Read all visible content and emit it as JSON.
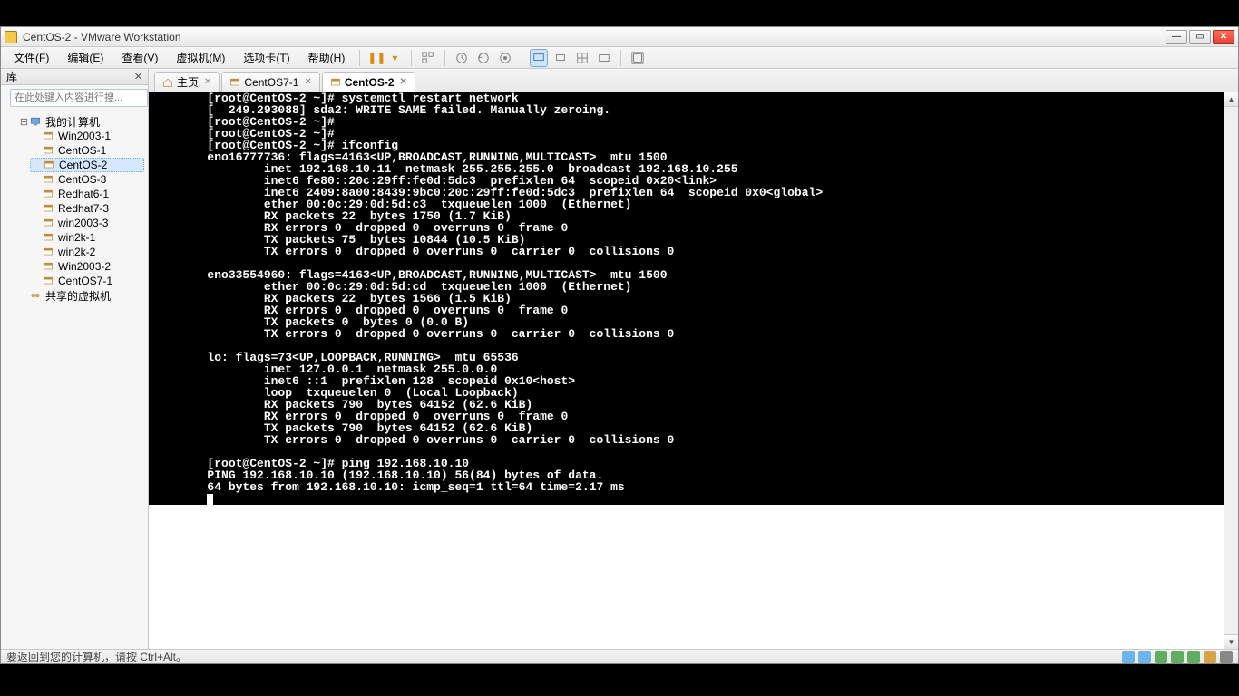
{
  "window": {
    "title": "CentOS-2 - VMware Workstation",
    "min": "—",
    "max": "▭",
    "close": "✕"
  },
  "menu": {
    "file": "文件(F)",
    "edit": "编辑(E)",
    "view": "查看(V)",
    "vm": "虚拟机(M)",
    "tabs": "选项卡(T)",
    "help": "帮助(H)"
  },
  "sidebar": {
    "header": "库",
    "search_placeholder": "在此处键入内容进行搜...",
    "root": "我的计算机",
    "items": [
      "Win2003-1",
      "CentOS-1",
      "CentOS-2",
      "CentOS-3",
      "Redhat6-1",
      "Redhat7-3",
      "win2003-3",
      "win2k-1",
      "win2k-2",
      "Win2003-2",
      "CentOS7-1"
    ],
    "shared": "共享的虚拟机"
  },
  "tabs": [
    {
      "label": "主页",
      "kind": "home",
      "closable": true
    },
    {
      "label": "CentOS7-1",
      "kind": "vm",
      "closable": true
    },
    {
      "label": "CentOS-2",
      "kind": "vm",
      "closable": true,
      "active": true
    }
  ],
  "terminal_lines": [
    "[root@CentOS-2 ~]# systemctl restart network",
    "[  249.293088] sda2: WRITE SAME failed. Manually zeroing.",
    "[root@CentOS-2 ~]#",
    "[root@CentOS-2 ~]#",
    "[root@CentOS-2 ~]# ifconfig",
    "eno16777736: flags=4163<UP,BROADCAST,RUNNING,MULTICAST>  mtu 1500",
    "        inet 192.168.10.11  netmask 255.255.255.0  broadcast 192.168.10.255",
    "        inet6 fe80::20c:29ff:fe0d:5dc3  prefixlen 64  scopeid 0x20<link>",
    "        inet6 2409:8a00:8439:9bc0:20c:29ff:fe0d:5dc3  prefixlen 64  scopeid 0x0<global>",
    "        ether 00:0c:29:0d:5d:c3  txqueuelen 1000  (Ethernet)",
    "        RX packets 22  bytes 1750 (1.7 KiB)",
    "        RX errors 0  dropped 0  overruns 0  frame 0",
    "        TX packets 75  bytes 10844 (10.5 KiB)",
    "        TX errors 0  dropped 0 overruns 0  carrier 0  collisions 0",
    "",
    "eno33554960: flags=4163<UP,BROADCAST,RUNNING,MULTICAST>  mtu 1500",
    "        ether 00:0c:29:0d:5d:cd  txqueuelen 1000  (Ethernet)",
    "        RX packets 22  bytes 1566 (1.5 KiB)",
    "        RX errors 0  dropped 0  overruns 0  frame 0",
    "        TX packets 0  bytes 0 (0.0 B)",
    "        TX errors 0  dropped 0 overruns 0  carrier 0  collisions 0",
    "",
    "lo: flags=73<UP,LOOPBACK,RUNNING>  mtu 65536",
    "        inet 127.0.0.1  netmask 255.0.0.0",
    "        inet6 ::1  prefixlen 128  scopeid 0x10<host>",
    "        loop  txqueuelen 0  (Local Loopback)",
    "        RX packets 790  bytes 64152 (62.6 KiB)",
    "        RX errors 0  dropped 0  overruns 0  frame 0",
    "        TX packets 790  bytes 64152 (62.6 KiB)",
    "        TX errors 0  dropped 0 overruns 0  carrier 0  collisions 0",
    "",
    "[root@CentOS-2 ~]# ping 192.168.10.10",
    "PING 192.168.10.10 (192.168.10.10) 56(84) bytes of data.",
    "64 bytes from 192.168.10.10: icmp_seq=1 ttl=64 time=2.17 ms"
  ],
  "statusbar": {
    "hint": "要返回到您的计算机，请按 Ctrl+Alt。"
  },
  "icons": {
    "play": "▶",
    "pause": "❚❚",
    "dd": "▾"
  },
  "tray_colors": [
    "#6fb4e8",
    "#6fb4e8",
    "#5fae5f",
    "#5fae5f",
    "#5fae5f",
    "#d8a24a",
    "#888"
  ]
}
